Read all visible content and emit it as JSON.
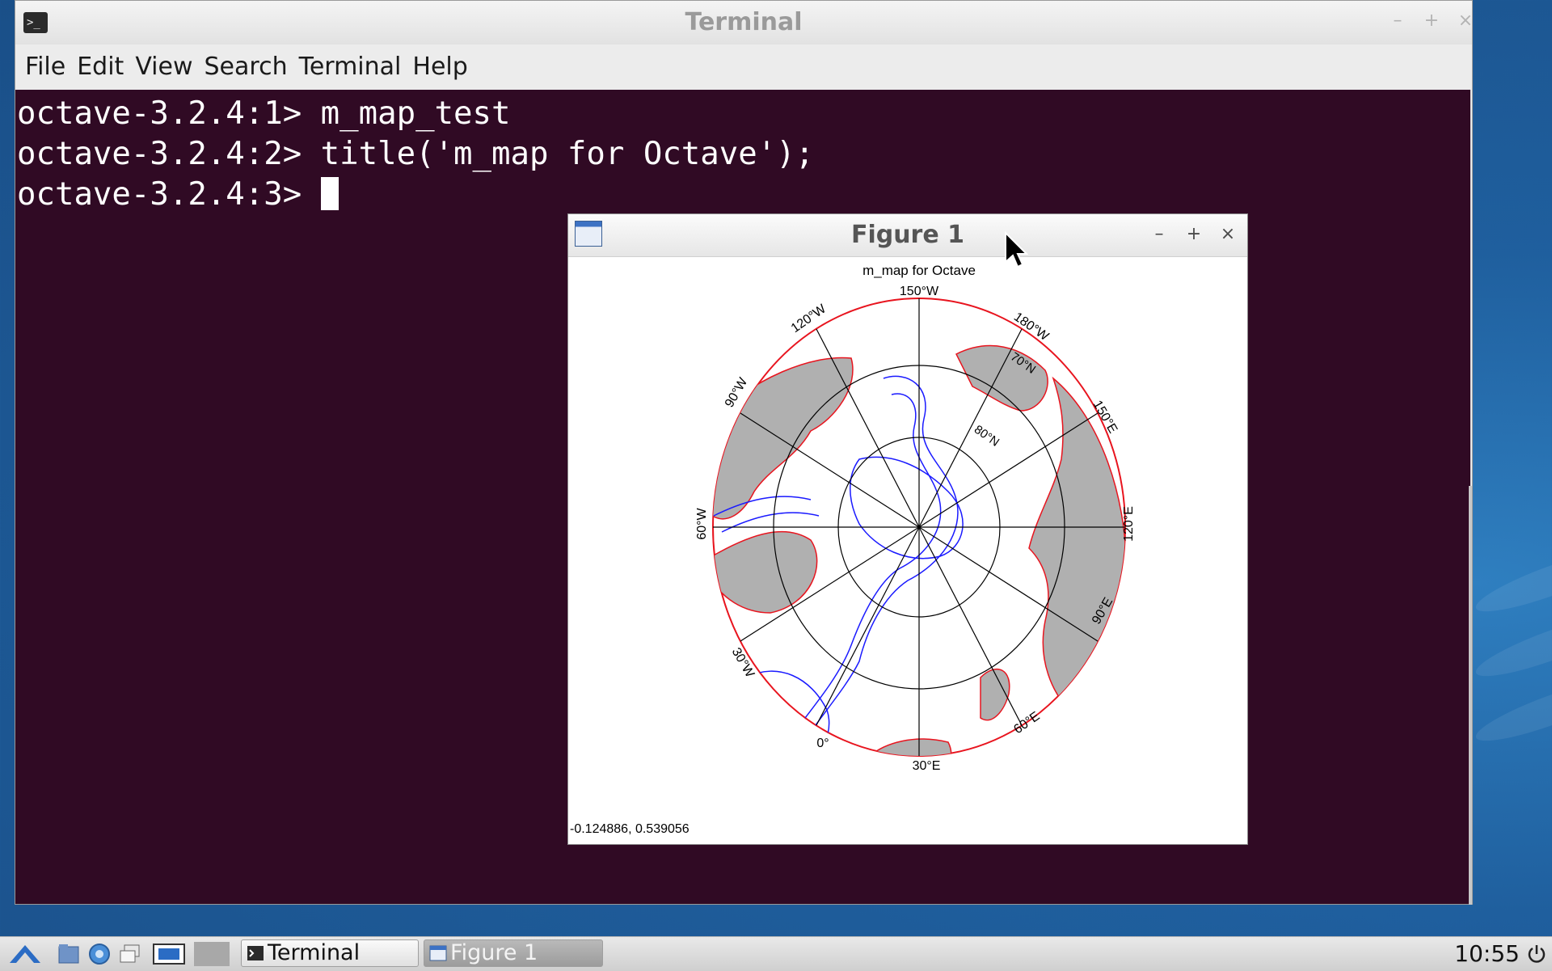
{
  "terminal": {
    "title": "Terminal",
    "window_controls": {
      "minimize": "–",
      "maximize": "+",
      "close": "×"
    },
    "menu": [
      "File",
      "Edit",
      "View",
      "Search",
      "Terminal",
      "Help"
    ],
    "lines": [
      "octave-3.2.4:1> m_map_test",
      "octave-3.2.4:2> title('m_map for Octave');",
      "octave-3.2.4:3> "
    ],
    "colors": {
      "background": "#300a24",
      "text": "#ffffff"
    }
  },
  "figure": {
    "title": "Figure 1",
    "window_controls": {
      "minimize": "–",
      "maximize": "+",
      "close": "×"
    },
    "plot_title": "m_map for Octave",
    "lon_labels": [
      "150°W",
      "120°W",
      "90°W",
      "60°W",
      "30°W",
      "0°",
      "30°E",
      "60°E",
      "90°E",
      "120°E",
      "150°E",
      "180°W"
    ],
    "lat_labels": [
      "70°N",
      "80°N"
    ],
    "coordinate_readout": "-0.124886,  0.539056",
    "colors": {
      "land": "#b0b0b0",
      "coastline": "#e8141e",
      "bathymetry": "#1a1aff",
      "grid": "#000000"
    }
  },
  "taskbar": {
    "tasks": [
      {
        "label": "Terminal",
        "active": false
      },
      {
        "label": "Figure 1",
        "active": true
      }
    ],
    "launcher_icons": [
      "start-menu-icon",
      "file-manager-icon",
      "browser-icon",
      "window-switch-icon",
      "show-desktop-icon",
      "workspace-icon"
    ],
    "clock": "10:55"
  }
}
